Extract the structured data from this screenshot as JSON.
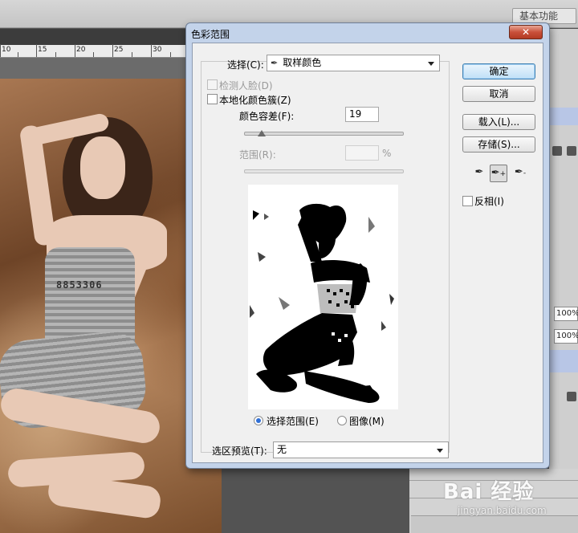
{
  "workspace": {
    "switcher_label": "基本功能",
    "ruler_numbers": [
      "10",
      "15",
      "20",
      "25",
      "30"
    ],
    "panel_percent_1": "100%",
    "panel_percent_2": "100%"
  },
  "dialog": {
    "title": "色彩范围",
    "close_label": "✕",
    "select_label": "选择(C):",
    "select_value": "取样颜色",
    "detect_faces_label": "检测人脸(D)",
    "localized_clusters_label": "本地化颜色簇(Z)",
    "fuzziness_label": "颜色容差(F):",
    "fuzziness_value": "19",
    "fuzziness_level": 0.11,
    "range_label": "范围(R):",
    "range_value": "",
    "range_unit": "%",
    "view_selection_label": "选择范围(E)",
    "view_image_label": "图像(M)",
    "view_selected": "selection",
    "preview_label": "选区预览(T):",
    "preview_value": "无",
    "buttons": {
      "ok": "确定",
      "cancel": "取消",
      "load": "载入(L)...",
      "save": "存储(S)..."
    },
    "invert_label": "反相(I)"
  },
  "watermark": {
    "main": "Bai 经验",
    "sub": "jingyan.baidu.com"
  },
  "colors": {
    "dialog_frame": "#c3d3ea",
    "dialog_body": "#f0f0f0",
    "default_button_border": "#3c7fb1",
    "close_button": "#c9503a"
  }
}
